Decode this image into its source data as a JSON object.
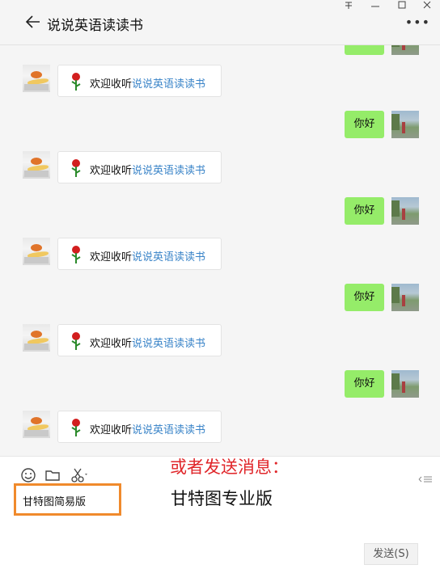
{
  "window": {
    "title": "说说英语读读书",
    "controls": [
      "pin-icon",
      "minimize-icon",
      "maximize-icon",
      "close-icon"
    ],
    "more_label": "•••"
  },
  "messages": [
    {
      "side": "left",
      "text": "欢迎收听",
      "link": "说说英语读读书"
    },
    {
      "side": "right",
      "text": "你好"
    },
    {
      "side": "left",
      "text": "欢迎收听",
      "link": "说说英语读读书"
    },
    {
      "side": "right",
      "text": "你好"
    },
    {
      "side": "left",
      "text": "欢迎收听",
      "link": "说说英语读读书"
    },
    {
      "side": "right",
      "text": "你好"
    },
    {
      "side": "left",
      "text": "欢迎收听",
      "link": "说说英语读读书"
    },
    {
      "side": "right",
      "text": "你好"
    },
    {
      "side": "left",
      "text": "欢迎收听",
      "link": "说说英语读读书"
    }
  ],
  "composer": {
    "tools": [
      "emoji-icon",
      "folder-icon",
      "scissors-icon"
    ],
    "typed_text": "甘特图简易版",
    "note_red": "或者发送消息：",
    "note_black": "甘特图专业版",
    "send_label": "发送(S)"
  },
  "colors": {
    "self_bubble": "#95ec69",
    "link": "#3a84c8",
    "note_red": "#e0262a",
    "highlight_box": "#f08a2c"
  }
}
